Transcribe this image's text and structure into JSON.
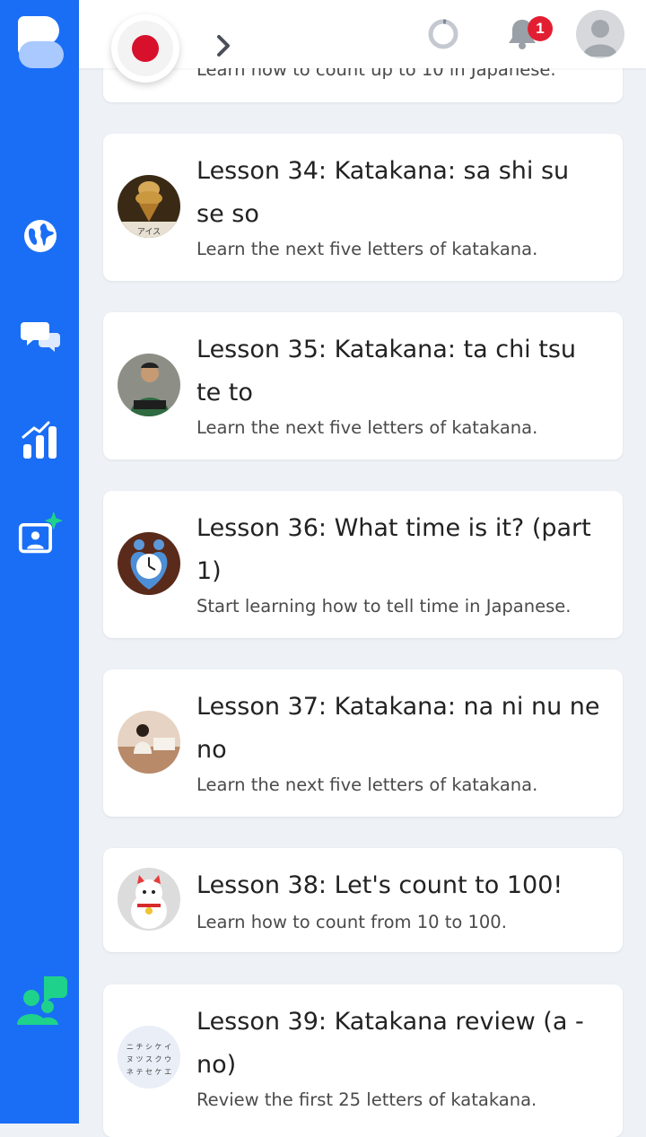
{
  "header": {
    "language_flag": "japan-flag-icon",
    "notification_count": "1"
  },
  "sidebar": {
    "items": [
      {
        "icon": "globe-icon"
      },
      {
        "icon": "chat-bubbles-icon"
      },
      {
        "icon": "stats-chart-icon"
      },
      {
        "icon": "ai-tutor-icon"
      },
      {
        "icon": "community-icon"
      }
    ]
  },
  "colors": {
    "sidebar": "#1a6ef5",
    "badge": "#e21f32",
    "community_icon": "#1fd28b"
  },
  "lessons": {
    "partial": {
      "description": "Learn how to count up to 10 in Japanese."
    },
    "items": [
      {
        "title": "Lesson 34: Katakana: sa shi su se so",
        "description": "Learn the next five letters of katakana."
      },
      {
        "title": "Lesson 35: Katakana: ta chi tsu te to",
        "description": "Learn the next five letters of katakana."
      },
      {
        "title": "Lesson 36: What time is it? (part 1)",
        "description": "Start learning how to tell time in Japanese."
      },
      {
        "title": "Lesson 37: Katakana: na ni nu ne no",
        "description": "Learn the next five letters of katakana."
      },
      {
        "title": "Lesson 38: Let's count to 100!",
        "description": "Learn how to count from 10 to 100."
      },
      {
        "title": "Lesson 39: Katakana review (a - no)",
        "description": "Review the first 25 letters of katakana."
      }
    ]
  },
  "thumb_captions": {
    "lesson34": "アイス",
    "lesson39_rows": [
      "ニ チ シ ケ イ",
      "ヌ ツ ス ク ウ",
      "ネ テ セ ケ エ"
    ]
  }
}
